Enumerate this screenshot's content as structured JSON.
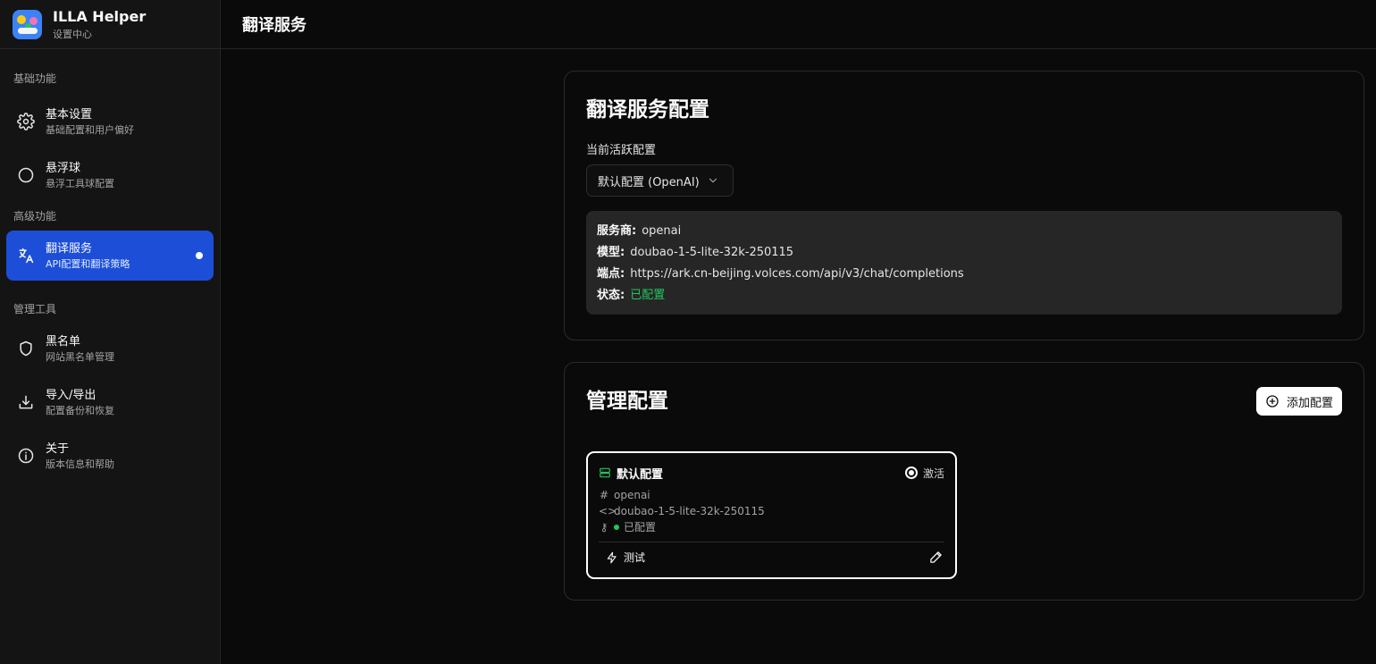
{
  "app": {
    "title": "ILLA Helper",
    "subtitle": "设置中心"
  },
  "sidebar": {
    "sections": [
      {
        "label": "基础功能"
      },
      {
        "label": "高级功能"
      },
      {
        "label": "管理工具"
      }
    ],
    "items": [
      {
        "label": "基本设置",
        "desc": "基础配置和用户偏好",
        "icon": "gear-icon"
      },
      {
        "label": "悬浮球",
        "desc": "悬浮工具球配置",
        "icon": "circle-icon"
      },
      {
        "label": "翻译服务",
        "desc": "API配置和翻译策略",
        "icon": "translate-icon",
        "active": true
      },
      {
        "label": "黑名单",
        "desc": "网站黑名单管理",
        "icon": "shield-icon"
      },
      {
        "label": "导入/导出",
        "desc": "配置备份和恢复",
        "icon": "download-icon"
      },
      {
        "label": "关于",
        "desc": "版本信息和帮助",
        "icon": "info-icon"
      }
    ]
  },
  "header": {
    "title": "翻译服务"
  },
  "service_config": {
    "title": "翻译服务配置",
    "active_label": "当前活跃配置",
    "selected": "默认配置 (OpenAI)",
    "info": {
      "provider_key": "服务商:",
      "provider": "openai",
      "model_key": "模型:",
      "model": "doubao-1-5-lite-32k-250115",
      "endpoint_key": "端点:",
      "endpoint": "https://ark.cn-beijing.volces.com/api/v3/chat/completions",
      "status_key": "状态:",
      "status": "已配置"
    }
  },
  "manage": {
    "title": "管理配置",
    "add_label": "添加配置",
    "configs": [
      {
        "name": "默认配置",
        "active_label": "激活",
        "provider": "openai",
        "model": "doubao-1-5-lite-32k-250115",
        "status": "已配置",
        "test_label": "测试"
      }
    ]
  },
  "colors": {
    "accent": "#1d4ed8",
    "ok": "#22c55e",
    "background": "#0a0a0a",
    "sidebar": "#141414"
  }
}
